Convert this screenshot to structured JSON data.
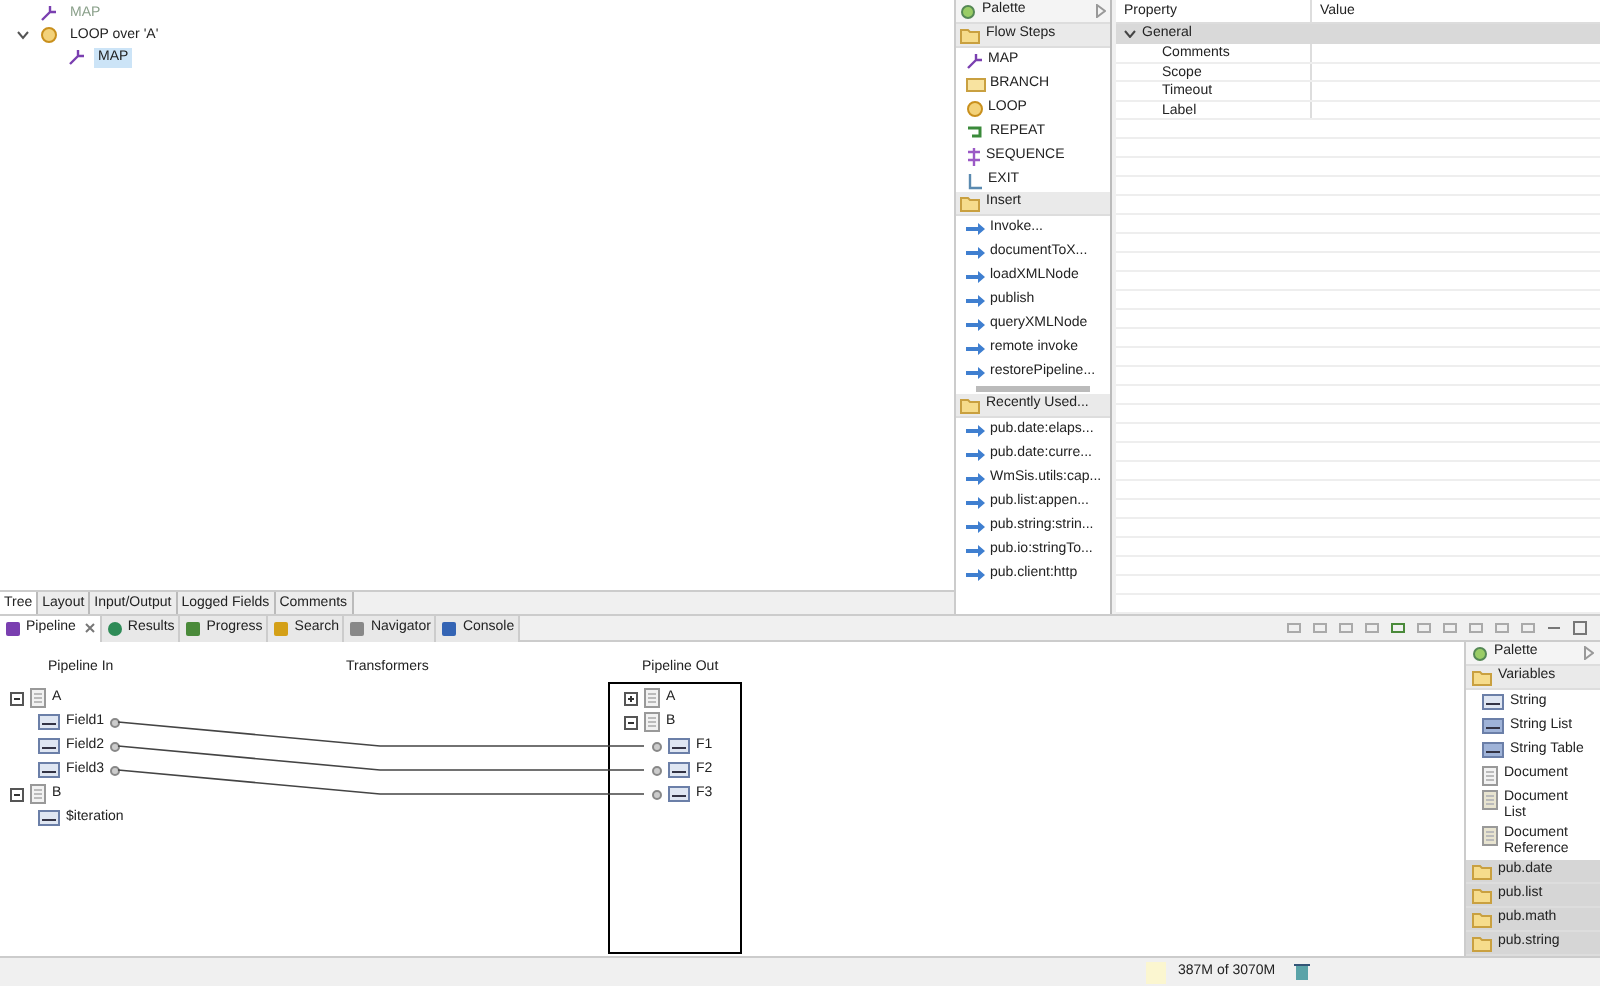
{
  "flow_tree": [
    {
      "label": "MAP",
      "kind": "map",
      "disabled": true,
      "selected": false
    },
    {
      "label": "LOOP over 'A'",
      "kind": "loop",
      "disabled": false,
      "selected": false,
      "expanded": true,
      "children": [
        {
          "label": "MAP",
          "kind": "map",
          "disabled": false,
          "selected": true
        }
      ]
    }
  ],
  "editor_tabs": [
    {
      "label": "Tree",
      "selected": true
    },
    {
      "label": "Layout",
      "selected": false
    },
    {
      "label": "Input/Output",
      "selected": false
    },
    {
      "label": "Logged Fields",
      "selected": false
    },
    {
      "label": "Comments",
      "selected": false
    }
  ],
  "flow_palette": {
    "title": "Palette",
    "sections": [
      {
        "title": "Flow Steps",
        "items": [
          {
            "label": "MAP",
            "kind": "map"
          },
          {
            "label": "BRANCH",
            "kind": "branch"
          },
          {
            "label": "LOOP",
            "kind": "loop"
          },
          {
            "label": "REPEAT",
            "kind": "repeat"
          },
          {
            "label": "SEQUENCE",
            "kind": "sequence"
          },
          {
            "label": "EXIT",
            "kind": "exit"
          }
        ]
      },
      {
        "title": "Insert",
        "items": [
          {
            "label": "Invoke...",
            "kind": "service"
          },
          {
            "label": "documentToX...",
            "kind": "service"
          },
          {
            "label": "loadXMLNode",
            "kind": "service"
          },
          {
            "label": "publish",
            "kind": "service"
          },
          {
            "label": "queryXMLNode",
            "kind": "service"
          },
          {
            "label": "remote invoke",
            "kind": "service"
          },
          {
            "label": "restorePipeline...",
            "kind": "service"
          }
        ]
      },
      {
        "title": "Recently Used...",
        "items": [
          {
            "label": "pub.date:elaps...",
            "kind": "service"
          },
          {
            "label": "pub.date:curre...",
            "kind": "service"
          },
          {
            "label": "WmSis.utils:cap...",
            "kind": "service"
          },
          {
            "label": "pub.list:appen...",
            "kind": "service"
          },
          {
            "label": "pub.string:strin...",
            "kind": "service"
          },
          {
            "label": "pub.io:stringTo...",
            "kind": "service"
          },
          {
            "label": "pub.client:http",
            "kind": "service"
          }
        ]
      }
    ]
  },
  "properties": {
    "columns": [
      "Property",
      "Value"
    ],
    "groups": [
      {
        "label": "General",
        "expanded": true,
        "rows": [
          "Comments",
          "Scope",
          "Timeout",
          "Label"
        ]
      }
    ]
  },
  "view_tabs": [
    {
      "label": "Pipeline",
      "kind": "pipeline",
      "selected": true,
      "closable": true
    },
    {
      "label": "Results",
      "kind": "results",
      "selected": false
    },
    {
      "label": "Progress",
      "kind": "progress",
      "selected": false
    },
    {
      "label": "Search",
      "kind": "search",
      "selected": false
    },
    {
      "label": "Navigator",
      "kind": "navigator",
      "selected": false
    },
    {
      "label": "Console",
      "kind": "console",
      "selected": false
    }
  ],
  "pipeline": {
    "headers": [
      "Pipeline In",
      "Transformers",
      "Pipeline Out"
    ],
    "pipeline_in": [
      {
        "label": "A",
        "kind": "document",
        "expanded": true,
        "children": [
          {
            "label": "Field1",
            "kind": "string",
            "mapped": true
          },
          {
            "label": "Field2",
            "kind": "string",
            "mapped": true
          },
          {
            "label": "Field3",
            "kind": "string",
            "mapped": true
          }
        ]
      },
      {
        "label": "B",
        "kind": "document",
        "expanded": true,
        "children": [
          {
            "label": "$iteration",
            "kind": "string",
            "mapped": false
          }
        ]
      }
    ],
    "pipeline_out": [
      {
        "label": "A",
        "kind": "document",
        "expanded": false
      },
      {
        "label": "B",
        "kind": "document",
        "expanded": true,
        "children": [
          {
            "label": "F1",
            "kind": "string",
            "mapped": true
          },
          {
            "label": "F2",
            "kind": "string",
            "mapped": true
          },
          {
            "label": "F3",
            "kind": "string",
            "mapped": true
          }
        ]
      }
    ]
  },
  "variables_palette": {
    "title": "Palette",
    "sections": [
      {
        "title": "Variables",
        "expanded": true,
        "items": [
          {
            "label": "String",
            "kind": "string"
          },
          {
            "label": "String List",
            "kind": "string_list"
          },
          {
            "label": "String Table",
            "kind": "string_table"
          },
          {
            "label": "Document",
            "kind": "document"
          },
          {
            "label": "Document List",
            "kind": "document_list"
          },
          {
            "label": "Document Reference",
            "kind": "document_reference"
          }
        ]
      },
      {
        "title": "pub.date",
        "expanded": false
      },
      {
        "title": "pub.list",
        "expanded": false
      },
      {
        "title": "pub.math",
        "expanded": false
      },
      {
        "title": "pub.string",
        "expanded": false
      }
    ]
  },
  "status_bar": {
    "memory": "387M of 3070M"
  }
}
